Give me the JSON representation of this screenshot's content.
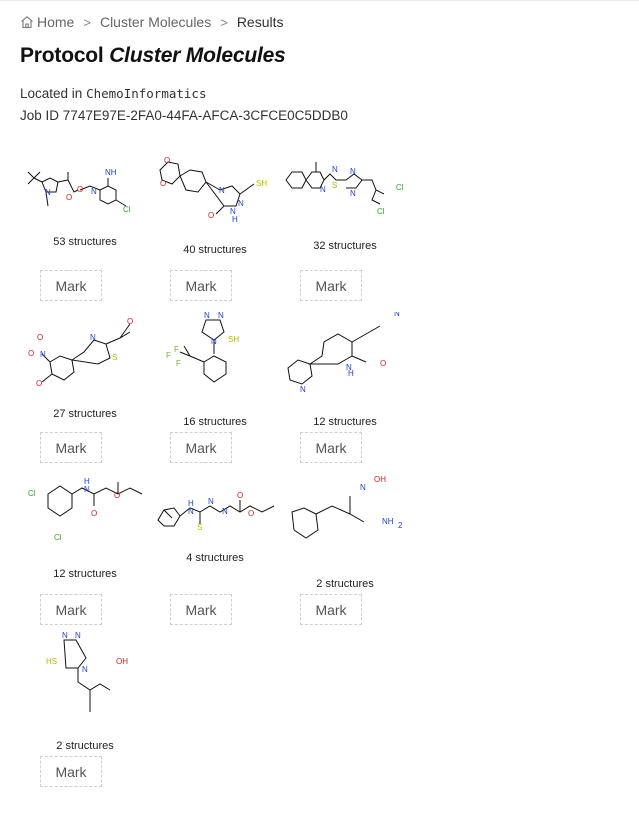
{
  "breadcrumb": {
    "home": "Home",
    "parent": "Cluster Molecules",
    "current": "Results",
    "separator": ">"
  },
  "title": {
    "prefix": "Protocol",
    "name": "Cluster Molecules"
  },
  "location": {
    "label": "Located in",
    "value": "ChemoInformatics"
  },
  "job": {
    "label": "Job ID",
    "value": "7747E97E-2FA0-44FA-AFCA-3CFCE0C5DDB0"
  },
  "colors": {
    "nitrogen": "#1f3fd6",
    "oxygen": "#d62020",
    "sulfur": "#b8b800",
    "chlorine": "#2aa82a",
    "fluorine": "#6ab820",
    "bond": "#111111"
  },
  "clusters": [
    {
      "count_label": "53 structures",
      "button": "Mark"
    },
    {
      "count_label": "40 structures",
      "button": "Mark"
    },
    {
      "count_label": "32 structures",
      "button": "Mark"
    },
    {
      "count_label": "27 structures",
      "button": "Mark"
    },
    {
      "count_label": "16 structures",
      "button": "Mark"
    },
    {
      "count_label": "12 structures",
      "button": "Mark"
    },
    {
      "count_label": "12 structures",
      "button": "Mark"
    },
    {
      "count_label": "4 structures",
      "button": "Mark"
    },
    {
      "count_label": "2 structures",
      "button": "Mark"
    },
    {
      "count_label": "2 structures",
      "button": "Mark"
    }
  ]
}
